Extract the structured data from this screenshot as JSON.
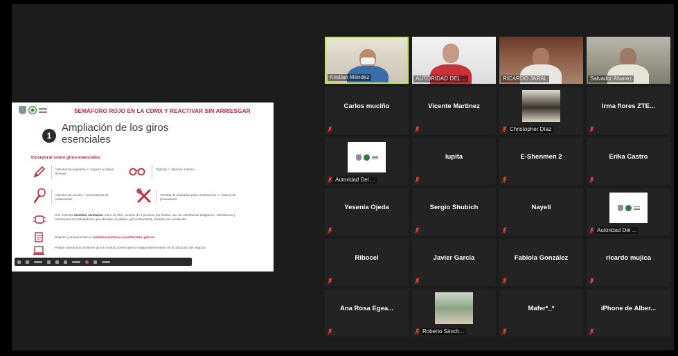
{
  "slide": {
    "title": "SEMÁFORO ROJO EN LA CDMX Y REACTIVAR SIN ARRIESGAR",
    "section_number": "1",
    "section_title": "Ampliación de los giros esenciales",
    "subheading": "Incorporar como giros esenciales:",
    "items": [
      {
        "icon": "pencil-icon",
        "text": "Artículos de papelería <- regreso a clases remotas"
      },
      {
        "icon": "glasses-icon",
        "text": "Ópticas <- atención médica"
      },
      {
        "icon": "whisk-icon",
        "text": "Artículos de cocina <- proveedores de restaurantes"
      },
      {
        "icon": "tools-icon",
        "text": "Tiendas de acabados para construcción <- cadena de proveeduría"
      }
    ],
    "paragraphs": [
      {
        "icon": "mask-icon",
        "text_pre": "Con estrictas ",
        "text_bold": "medidas sanitarias",
        "text_post": ": aforo de 20%, acceso de 1 persona por familia, uso de cubrebocas obligatorio, cubrebocas y careta para los trabajadores que atienden al público, gel antibacterial, medidas de ventilación."
      },
      {
        "icon": "document-icon",
        "text_pre": "Registro y lineamientos en ",
        "link": "medidassanitarias.covid19.cdmx.gob.mx"
      },
      {
        "icon": "laptop-icon",
        "text_pre": "Podrán operar aun al interior de los centros comerciales e independientemente de la ubicación del negocio."
      }
    ]
  },
  "participants": [
    {
      "name": "Kristian Méndez",
      "display": "video",
      "muted": false,
      "active_speaker": true
    },
    {
      "name": "AUTORIDAD DEL ...",
      "display": "video",
      "muted": false
    },
    {
      "name": "RICARDO JARAL",
      "display": "video",
      "muted": false
    },
    {
      "name": "Salvador Álvarez",
      "display": "video",
      "muted": false
    },
    {
      "name": "Carlos muciño",
      "display": "name",
      "muted": true
    },
    {
      "name": "Vicente Martinez",
      "display": "name",
      "muted": true
    },
    {
      "name": "Christopher Díaz",
      "display": "photo",
      "muted": true
    },
    {
      "name": "Irma flores ZTE...",
      "display": "name",
      "muted": true
    },
    {
      "name": "Autoridad Del ...",
      "display": "logo",
      "muted": true
    },
    {
      "name": "lupita",
      "display": "name",
      "muted": true
    },
    {
      "name": "E-Shenmen 2",
      "display": "name",
      "muted": true
    },
    {
      "name": "Erika Castro",
      "display": "name",
      "muted": true
    },
    {
      "name": "Yesenia Ojeda",
      "display": "name",
      "muted": true
    },
    {
      "name": "Sergio Shubich",
      "display": "name",
      "muted": true
    },
    {
      "name": "Nayeli",
      "display": "name",
      "muted": true
    },
    {
      "name": "Autoridad Del ...",
      "display": "logo",
      "muted": true
    },
    {
      "name": "Ribocel",
      "display": "name",
      "muted": true
    },
    {
      "name": "Javier García",
      "display": "name",
      "muted": true
    },
    {
      "name": "Fabiola González",
      "display": "name",
      "muted": true
    },
    {
      "name": "ricardo mujica",
      "display": "name",
      "muted": true
    },
    {
      "name": "Ana Rosa Egea...",
      "display": "name",
      "muted": true
    },
    {
      "name": "Roberto Sánch...",
      "display": "photo",
      "muted": true
    },
    {
      "name": "Mafer*_*",
      "display": "name",
      "muted": true
    },
    {
      "name": "iPhone de Alber...",
      "display": "name",
      "muted": true
    }
  ],
  "colors": {
    "active_speaker_border": "#c8e34a",
    "mute_red": "#e0413a",
    "slide_accent": "#c0273a"
  }
}
